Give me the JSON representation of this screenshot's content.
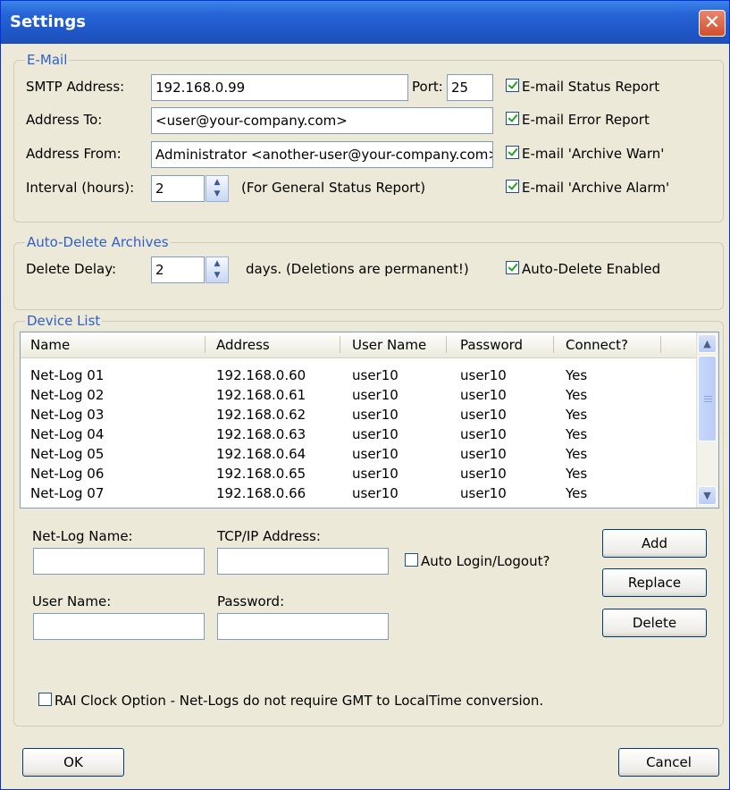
{
  "window": {
    "title": "Settings"
  },
  "email": {
    "group_label": "E-Mail",
    "smtp_label": "SMTP Address:",
    "smtp_value": "192.168.0.99",
    "port_label": "Port:",
    "port_value": "25",
    "to_label": "Address To:",
    "to_value": "<user@your-company.com>",
    "from_label": "Address From:",
    "from_value": "Administrator <another-user@your-company.com>",
    "interval_label": "Interval (hours):",
    "interval_value": "2",
    "interval_note": "(For General Status Report)",
    "checks": [
      {
        "label": "E-mail Status Report",
        "checked": true
      },
      {
        "label": "E-mail Error Report",
        "checked": true
      },
      {
        "label": "E-mail 'Archive Warn'",
        "checked": true
      },
      {
        "label": "E-mail 'Archive Alarm'",
        "checked": true
      }
    ]
  },
  "autodelete": {
    "group_label": "Auto-Delete Archives",
    "delay_label": "Delete Delay:",
    "delay_value": "2",
    "days_note": "days. (Deletions are permanent!)",
    "enabled_label": "Auto-Delete Enabled",
    "enabled_checked": true
  },
  "devices": {
    "group_label": "Device List",
    "columns": [
      "Name",
      "Address",
      "User Name",
      "Password",
      "Connect?"
    ],
    "rows": [
      [
        "Net-Log 01",
        "192.168.0.60",
        "user10",
        "user10",
        "Yes"
      ],
      [
        "Net-Log 02",
        "192.168.0.61",
        "user10",
        "user10",
        "Yes"
      ],
      [
        "Net-Log 03",
        "192.168.0.62",
        "user10",
        "user10",
        "Yes"
      ],
      [
        "Net-Log 04",
        "192.168.0.63",
        "user10",
        "user10",
        "Yes"
      ],
      [
        "Net-Log 05",
        "192.168.0.64",
        "user10",
        "user10",
        "Yes"
      ],
      [
        "Net-Log 06",
        "192.168.0.65",
        "user10",
        "user10",
        "Yes"
      ],
      [
        "Net-Log 07",
        "192.168.0.66",
        "user10",
        "user10",
        "Yes"
      ]
    ],
    "name_label": "Net-Log Name:",
    "name_value": "",
    "ip_label": "TCP/IP Address:",
    "ip_value": "",
    "auto_login_label": "Auto Login/Logout?",
    "auto_login_checked": false,
    "user_label": "User Name:",
    "user_value": "",
    "password_label": "Password:",
    "password_value": "",
    "add_label": "Add",
    "replace_label": "Replace",
    "delete_label": "Delete",
    "rai_label": "RAI Clock Option - Net-Logs do not require GMT to LocalTime conversion.",
    "rai_checked": false
  },
  "footer": {
    "ok_label": "OK",
    "cancel_label": "Cancel"
  },
  "icons": {
    "close": "close-icon",
    "spin": "spin-updown-icon",
    "scroll_up": "chevron-up-icon",
    "scroll_down": "chevron-down-icon"
  }
}
